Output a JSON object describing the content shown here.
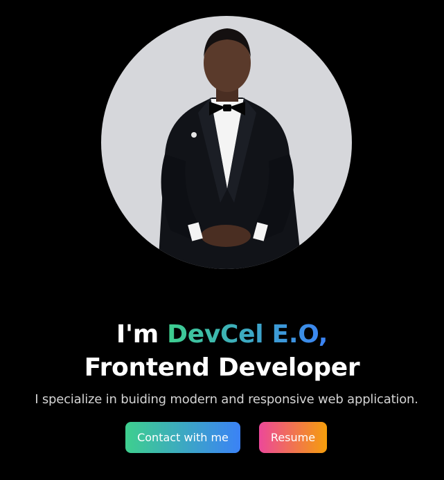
{
  "hero": {
    "greeting": "I'm",
    "name": "DevCel E.O,",
    "role": "Frontend Developer",
    "tagline": "I specialize in buiding modern and responsive web application."
  },
  "buttons": {
    "contact_label": "Contact with me",
    "resume_label": "Resume"
  },
  "colors": {
    "background": "#000000",
    "name_gradient_start": "#3ecf8e",
    "name_gradient_end": "#3b82f6",
    "resume_gradient_start": "#ec4899",
    "resume_gradient_end": "#f59e0b",
    "avatar_bg": "#d6d7db"
  }
}
